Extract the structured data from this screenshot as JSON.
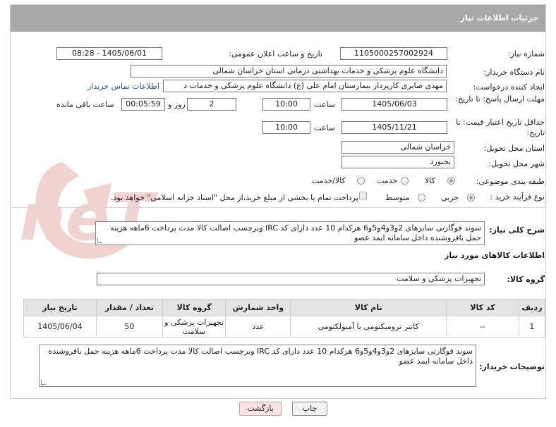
{
  "header": {
    "title": "جزئیات اطلاعات نیاز"
  },
  "fields": {
    "need_number_label": "شماره نیاز:",
    "need_number": "1105000257002924",
    "announce_label": "تاریخ و ساعت اعلان عمومی:",
    "announce_value": "1405/06/01 - 08:28",
    "buyer_org_label": "نام دستگاه خریدار:",
    "buyer_org": "دانشگاه علوم پزشکی و خدمات بهداشتی درمانی استان خراسان شمالی",
    "creator_label": "ایجاد کننده درخواست:",
    "creator": "مهدی صابری کارپرداز بیمارستان امام علی (ع) دانشگاه علوم پزشکی و خدمات د",
    "contact_link": "اطلاعات تماس خریدار",
    "deadline_label": "مهلت ارسال پاسخ: تا تاریخ:",
    "deadline_date": "1405/06/03",
    "time_label": "ساعت",
    "deadline_time": "10:00",
    "days_value": "2",
    "days_label": "روز و",
    "remaining_time": "00:05:59",
    "remaining_label": "ساعت باقی مانده",
    "price_valid_label": "حداقل تاریخ اعتبار قیمت: تا تاریخ:",
    "price_valid_date": "1405/11/21",
    "price_valid_time": "10:00",
    "province_label": "استان محل تحویل:",
    "province": "خراسان شمالی",
    "city_label": "شهر محل تحویل:",
    "city": "بجنورد",
    "category_label": "طبقه بندی موضوعی:",
    "category_options": [
      "کالا",
      "خدمت",
      "کالا/خدمت"
    ],
    "category_selected": "کالا",
    "process_label": "نوع فرآیند خرید :",
    "process_options": [
      "جزیی",
      "متوسط"
    ],
    "process_selected": "جزیی",
    "payment_note": "پرداخت تمام یا بخشی از مبلغ خرید،از محل \"اسناد خزانه اسلامی\" خواهد بود.",
    "summary_label": "شرح کلی نیاز:",
    "summary": "سوند فوگارتی سایزهای 2و3و4و5و6 هرکدام 10 عدد دارای  کد IRC وبرچسب اصالت کالا مدت پرداخت 6ماهه هزینه حمل بافروشنده داخل سامانه ایمد عضو"
  },
  "goods": {
    "section_title": "اطلاعات کالاهای مورد نیاز",
    "group_label": "گروه کالا:",
    "group_value": "تجهیزات پزشکی و سلامت",
    "columns": [
      "ردیف",
      "کد کالا",
      "نام کالا",
      "واحد شمارش",
      "گروه کالا",
      "تعداد / مقدار",
      "تاریخ نیاز"
    ],
    "rows": [
      {
        "row": "1",
        "code": "--",
        "name": "کاتتر ترومبکتومی یا آمبولکتومی",
        "unit": "عدد",
        "group": "تجهیزات پزشکی و سلامت",
        "qty": "50",
        "date": "1405/06/04"
      }
    ]
  },
  "buyer_notes": {
    "label": "توضیحات خریدار:",
    "text": "سوند فوگارتی سایزهای 2و3و4و5و6 هرکدام 10 عدد دارای  کد IRC وبرچسب اصالت کالا مدت پرداخت 6ماهه هزینه حمل بافروشنده داخل سامانه ایمد عضو"
  },
  "buttons": {
    "print": "چاپ",
    "back": "بازگشت"
  },
  "watermark": {
    "text": "AriaTender.neT",
    "color": "#c0392b"
  }
}
